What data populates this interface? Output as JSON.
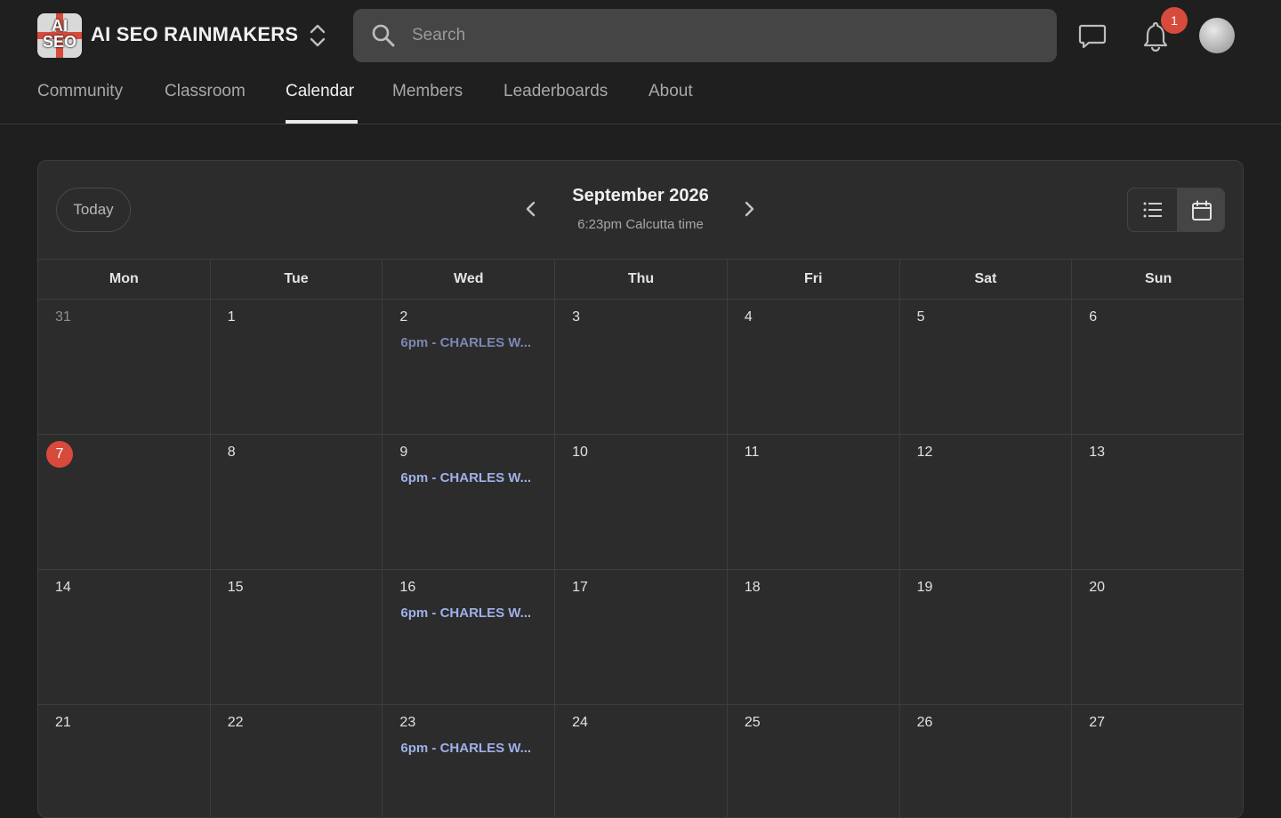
{
  "app": {
    "logo_text": "AI SEO",
    "name": "AI SEO RAINMAKERS"
  },
  "search": {
    "placeholder": "Search"
  },
  "notifications": {
    "count": "1"
  },
  "tabs": [
    {
      "label": "Community"
    },
    {
      "label": "Classroom"
    },
    {
      "label": "Calendar",
      "active": true
    },
    {
      "label": "Members"
    },
    {
      "label": "Leaderboards"
    },
    {
      "label": "About"
    }
  ],
  "calendar": {
    "today_label": "Today",
    "month_title": "September 2026",
    "timezone_label": "6:23pm Calcutta time",
    "views": [
      "list",
      "calendar"
    ],
    "active_view": "calendar",
    "weekdays": [
      "Mon",
      "Tue",
      "Wed",
      "Thu",
      "Fri",
      "Sat",
      "Sun"
    ],
    "weeks": [
      [
        {
          "day": "31",
          "muted": true
        },
        {
          "day": "1"
        },
        {
          "day": "2",
          "event": "6pm - CHARLES W...",
          "past": true
        },
        {
          "day": "3"
        },
        {
          "day": "4"
        },
        {
          "day": "5"
        },
        {
          "day": "6"
        }
      ],
      [
        {
          "day": "7",
          "today": true
        },
        {
          "day": "8"
        },
        {
          "day": "9",
          "event": "6pm - CHARLES W..."
        },
        {
          "day": "10"
        },
        {
          "day": "11"
        },
        {
          "day": "12"
        },
        {
          "day": "13"
        }
      ],
      [
        {
          "day": "14"
        },
        {
          "day": "15"
        },
        {
          "day": "16",
          "event": "6pm - CHARLES W..."
        },
        {
          "day": "17"
        },
        {
          "day": "18"
        },
        {
          "day": "19"
        },
        {
          "day": "20"
        }
      ],
      [
        {
          "day": "21"
        },
        {
          "day": "22"
        },
        {
          "day": "23",
          "event": "6pm - CHARLES W..."
        },
        {
          "day": "24"
        },
        {
          "day": "25"
        },
        {
          "day": "26"
        },
        {
          "day": "27"
        }
      ]
    ]
  },
  "colors": {
    "background": "#1f1f1f",
    "card": "#2c2c2c",
    "accent_red": "#d84b3c",
    "event_text": "#9fb0ea"
  }
}
